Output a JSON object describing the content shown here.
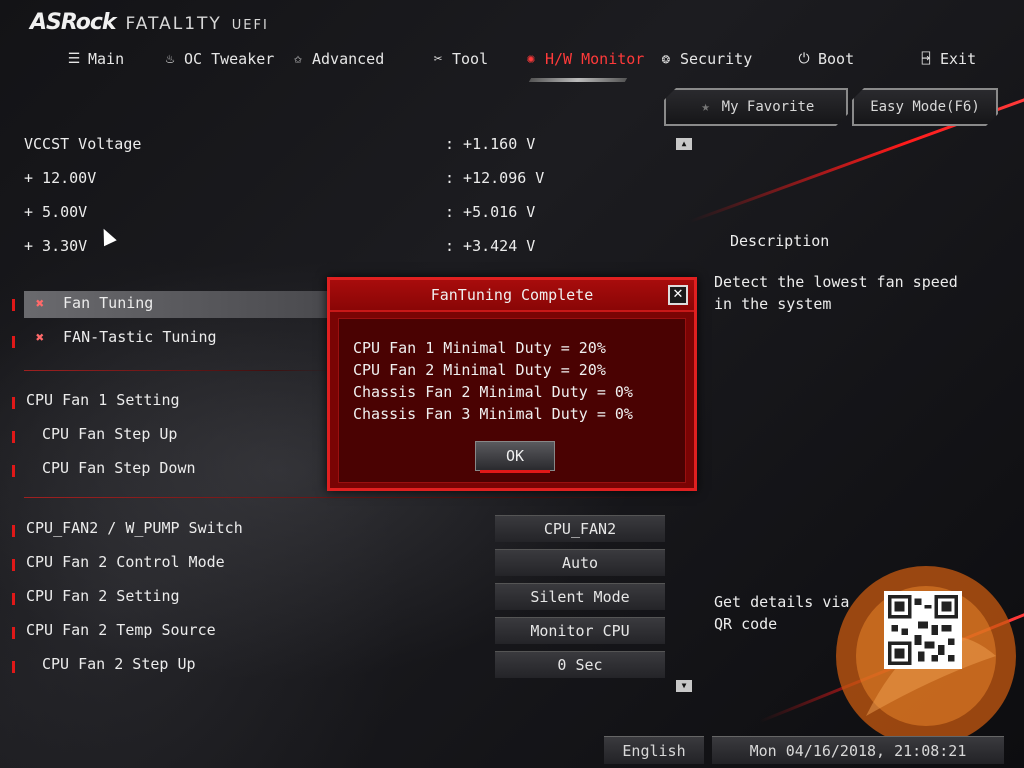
{
  "logo": {
    "brand": "ASRock",
    "product": "FATAL1TY",
    "suffix": "UEFI"
  },
  "nav": [
    {
      "label": "Main",
      "icon": "list-icon"
    },
    {
      "label": "OC Tweaker",
      "icon": "rocket-icon"
    },
    {
      "label": "Advanced",
      "icon": "star-icon"
    },
    {
      "label": "Tool",
      "icon": "tools-icon"
    },
    {
      "label": "H/W Monitor",
      "icon": "monitor-icon"
    },
    {
      "label": "Security",
      "icon": "shield-icon"
    },
    {
      "label": "Boot",
      "icon": "power-icon"
    },
    {
      "label": "Exit",
      "icon": "exit-icon"
    }
  ],
  "active_tab": "H/W Monitor",
  "top_buttons": {
    "favorite": "My Favorite",
    "easy_mode": "Easy Mode(F6)"
  },
  "voltages": [
    {
      "label": "VCCST Voltage",
      "value": ": +1.160 V"
    },
    {
      "label": "+ 12.00V",
      "value": ": +12.096 V"
    },
    {
      "label": "+ 5.00V",
      "value": ": +5.016 V"
    },
    {
      "label": "+ 3.30V",
      "value": ": +3.424 V"
    }
  ],
  "tuning": {
    "fan_tuning": "Fan Tuning",
    "fan_tastic": "FAN-Tastic Tuning"
  },
  "cpu_fan1": {
    "setting": "CPU Fan 1 Setting",
    "step_up": "CPU Fan Step Up",
    "step_down": "CPU Fan Step Down"
  },
  "settings": [
    {
      "label": "CPU_FAN2 / W_PUMP Switch",
      "value": "CPU_FAN2"
    },
    {
      "label": "CPU Fan 2 Control Mode",
      "value": "Auto"
    },
    {
      "label": "CPU Fan 2 Setting",
      "value": "Silent Mode"
    },
    {
      "label": "CPU Fan 2 Temp Source",
      "value": "Monitor CPU"
    },
    {
      "label": "CPU Fan 2 Step Up",
      "value": "0 Sec"
    }
  ],
  "description": {
    "title": "Description",
    "text": "Detect the lowest fan speed in the system"
  },
  "qr_label": "Get details via QR code",
  "footer": {
    "language": "English",
    "datetime": "Mon 04/16/2018, 21:08:21"
  },
  "dialog": {
    "title": "FanTuning Complete",
    "lines": [
      "CPU Fan 1 Minimal Duty = 20%",
      "CPU Fan 2 Minimal Duty = 20%",
      "Chassis Fan 2 Minimal Duty = 0%",
      "Chassis Fan 3 Minimal Duty = 0%"
    ],
    "ok": "OK",
    "close_symbol": "✕"
  },
  "colors": {
    "accent": "#e01818",
    "dialog": "#7a0404",
    "active_tab": "#ff3a3a"
  }
}
